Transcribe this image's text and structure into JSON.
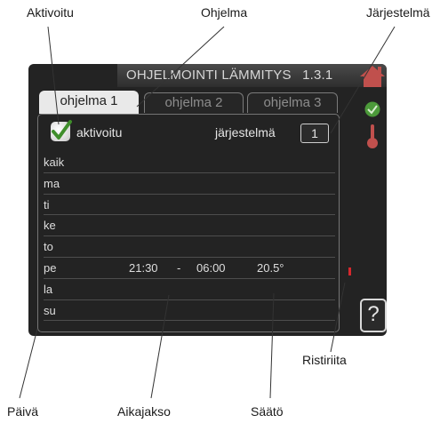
{
  "callouts": {
    "aktivoitu": "Aktivoitu",
    "ohjelma": "Ohjelma",
    "jarjestelma": "Järjestelmä",
    "ristiriita": "Ristiriita",
    "paiva": "Päivä",
    "aikajakso": "Aikajakso",
    "saato": "Säätö"
  },
  "screen": {
    "title": "OHJELMOINTI LÄMMITYS",
    "menu_number": "1.3.1",
    "tabs": [
      {
        "label": "ohjelma 1",
        "active": true
      },
      {
        "label": "ohjelma 2",
        "active": false
      },
      {
        "label": "ohjelma 3",
        "active": false
      }
    ],
    "activated_label": "aktivoitu",
    "activated_checked": true,
    "system_label": "järjestelmä",
    "system_value": "1",
    "schedule": [
      {
        "day": "kaik",
        "start": "",
        "sep": "",
        "end": "",
        "setting": ""
      },
      {
        "day": "ma",
        "start": "",
        "sep": "",
        "end": "",
        "setting": ""
      },
      {
        "day": "ti",
        "start": "",
        "sep": "",
        "end": "",
        "setting": ""
      },
      {
        "day": "ke",
        "start": "",
        "sep": "",
        "end": "",
        "setting": ""
      },
      {
        "day": "to",
        "start": "",
        "sep": "",
        "end": "",
        "setting": ""
      },
      {
        "day": "pe",
        "start": "21:30",
        "sep": "-",
        "end": "06:00",
        "setting": "20.5°"
      },
      {
        "day": "la",
        "start": "",
        "sep": "",
        "end": "",
        "setting": ""
      },
      {
        "day": "su",
        "start": "",
        "sep": "",
        "end": "",
        "setting": ""
      }
    ],
    "help_symbol": "?"
  },
  "icons": [
    "house-icon",
    "status-indicator-icon",
    "thermometer-icon",
    "conflict-marker-icon"
  ],
  "colors": {
    "screen_bg": "#232323",
    "house": "#c0504d",
    "status_green": "#4c9a3a",
    "conflict_red": "#d6282d"
  }
}
